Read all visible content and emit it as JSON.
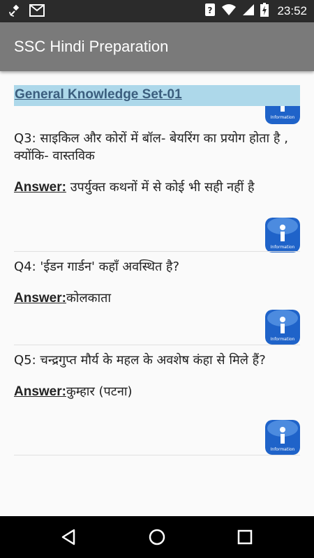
{
  "status_bar": {
    "time": "23:52",
    "icons": [
      "satellite-icon",
      "gmail-icon",
      "nfc-icon",
      "wifi-icon",
      "signal-icon",
      "battery-charging-icon"
    ]
  },
  "app_bar": {
    "title": "SSC Hindi Preparation"
  },
  "set_title": "General Knowledge Set-01",
  "answer_label": "Answer:",
  "questions": [
    {
      "q": "Q3: साइकिल और कोरों में बॉल- बेयरिंग का प्रयोग होता है , क्योंकि-   वास्तविक",
      "a": " उपर्युक्त कथनों में से कोई भी सही नहीं है"
    },
    {
      "q": "Q4: 'ईडन गार्डन' कहाँ अवस्थित है?",
      "a": "कोलकाता"
    },
    {
      "q": "Q5: चन्द्रगुप्त मौर्य के महल के अवशेष कंहा से मिले हैं?",
      "a": "कुम्हार (पटना)"
    }
  ],
  "info_button_label": "Information",
  "colors": {
    "app_bar": "#7a7a7a",
    "status_bar": "#2b2b2b",
    "set_title_bg": "#add8ea",
    "set_title_text": "#3b5e7e",
    "info_button": "#1f63c9"
  }
}
